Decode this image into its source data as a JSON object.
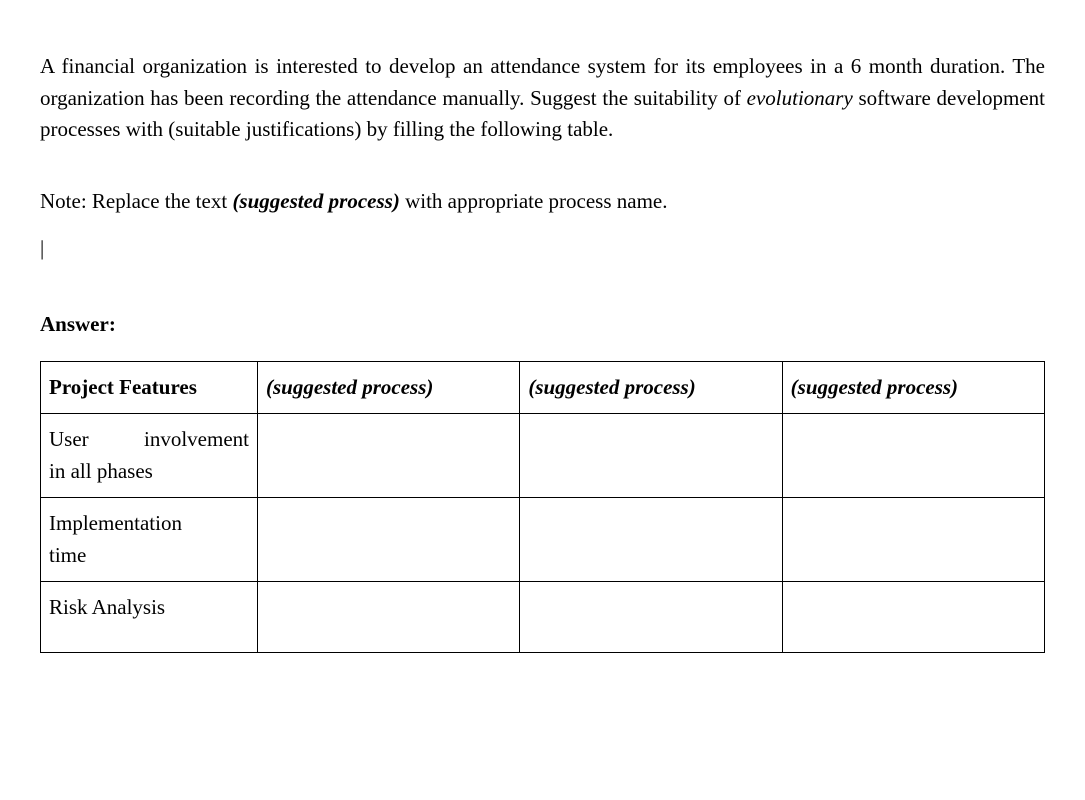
{
  "intro": {
    "pre": "A financial organization is interested to develop an attendance system for its employees in a 6 month duration. The organization has been recording the attendance manually. Suggest the suitability of ",
    "em": "evolutionary",
    "post": " software development processes with (suitable justifications) by filling the following table."
  },
  "note": {
    "pre": "Note: Replace the text ",
    "bi": "(suggested process)",
    "post": " with appropriate process name."
  },
  "cursor": "|",
  "answer_label": "Answer:",
  "table": {
    "headers": {
      "col1": "Project Features",
      "col2": "(suggested process)",
      "col3": "(suggested process)",
      "col4": "(suggested process)"
    },
    "rows": [
      {
        "label_line1": "User involvement",
        "label_line2": "in all phases",
        "c2": "",
        "c3": "",
        "c4": ""
      },
      {
        "label_line1": "Implementation",
        "label_line2": "time",
        "c2": "",
        "c3": "",
        "c4": ""
      },
      {
        "label_line1": "Risk Analysis",
        "label_line2": "",
        "c2": "",
        "c3": "",
        "c4": ""
      }
    ]
  }
}
